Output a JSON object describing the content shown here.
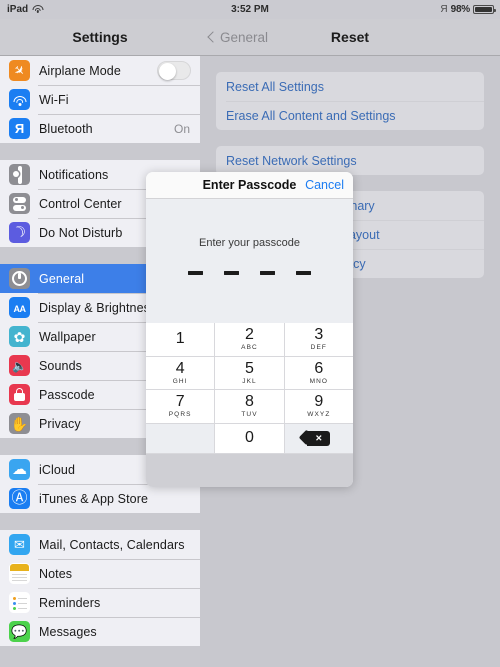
{
  "statusbar": {
    "device": "iPad",
    "wifi_icon": "wifi-icon",
    "time": "3:52 PM",
    "bluetooth_icon": "bluetooth-icon",
    "battery_percent": "98%"
  },
  "sidebar": {
    "title": "Settings",
    "groups": [
      {
        "items": [
          {
            "label": "Airplane Mode",
            "icon": "airplane-icon",
            "icon_color": "#ef8a21",
            "control": "toggle",
            "toggle_on": false
          },
          {
            "label": "Wi-Fi",
            "icon": "wifi-icon",
            "icon_color": "#1b7ef2"
          },
          {
            "label": "Bluetooth",
            "icon": "bluetooth-icon",
            "icon_color": "#1b7ef2",
            "value": "On"
          }
        ]
      },
      {
        "items": [
          {
            "label": "Notifications",
            "icon": "notifications-icon",
            "icon_color": "#8e8e93"
          },
          {
            "label": "Control Center",
            "icon": "control-center-icon",
            "icon_color": "#8e8e93"
          },
          {
            "label": "Do Not Disturb",
            "icon": "do-not-disturb-icon",
            "icon_color": "#5c5ce0"
          }
        ]
      },
      {
        "items": [
          {
            "label": "General",
            "icon": "gear-icon",
            "icon_color": "#8e8e93",
            "selected": true
          },
          {
            "label": "Display & Brightness",
            "icon": "display-brightness-icon",
            "icon_color": "#1b7ef2"
          },
          {
            "label": "Wallpaper",
            "icon": "wallpaper-icon",
            "icon_color": "#44b4cf"
          },
          {
            "label": "Sounds",
            "icon": "sounds-icon",
            "icon_color": "#e8384f"
          },
          {
            "label": "Passcode",
            "icon": "passcode-lock-icon",
            "icon_color": "#e8384f"
          },
          {
            "label": "Privacy",
            "icon": "privacy-hand-icon",
            "icon_color": "#8e8e93"
          }
        ]
      },
      {
        "items": [
          {
            "label": "iCloud",
            "icon": "icloud-icon",
            "icon_color": "#3aa5f0"
          },
          {
            "label": "iTunes & App Store",
            "icon": "app-store-icon",
            "icon_color": "#1b7ef2"
          }
        ]
      },
      {
        "items": [
          {
            "label": "Mail, Contacts, Calendars",
            "icon": "mail-icon",
            "icon_color": "#32a6f0"
          },
          {
            "label": "Notes",
            "icon": "notes-icon",
            "icon_color": "#e8b21c"
          },
          {
            "label": "Reminders",
            "icon": "reminders-icon",
            "icon_color": "#ffffff"
          },
          {
            "label": "Messages",
            "icon": "messages-icon",
            "icon_color": "#4cd24c"
          }
        ]
      }
    ]
  },
  "detail": {
    "back_label": "General",
    "title": "Reset",
    "sections": [
      {
        "options": [
          "Reset All Settings",
          "Erase All Content and Settings"
        ]
      },
      {
        "options": [
          "Reset Network Settings"
        ]
      },
      {
        "options": [
          "Reset Keyboard Dictionary",
          "Reset Home Screen Layout",
          "Reset Location & Privacy"
        ]
      }
    ]
  },
  "modal": {
    "title": "Enter Passcode",
    "cancel_label": "Cancel",
    "prompt": "Enter your passcode",
    "passcode_length": 4,
    "entered_digits": 0,
    "keypad": [
      {
        "digit": "1",
        "letters": ""
      },
      {
        "digit": "2",
        "letters": "ABC"
      },
      {
        "digit": "3",
        "letters": "DEF"
      },
      {
        "digit": "4",
        "letters": "GHI"
      },
      {
        "digit": "5",
        "letters": "JKL"
      },
      {
        "digit": "6",
        "letters": "MNO"
      },
      {
        "digit": "7",
        "letters": "PQRS"
      },
      {
        "digit": "8",
        "letters": "TUV"
      },
      {
        "digit": "9",
        "letters": "WXYZ"
      },
      {
        "digit": "0",
        "letters": ""
      }
    ],
    "delete_icon": "delete-backspace-icon"
  },
  "colors": {
    "accent_blue": "#1b7ef2",
    "link_blue": "#3b6cb5",
    "selected_row": "#3d7fe8",
    "panel_bg": "#c8c8ce",
    "group_bg": "#efeff4"
  }
}
